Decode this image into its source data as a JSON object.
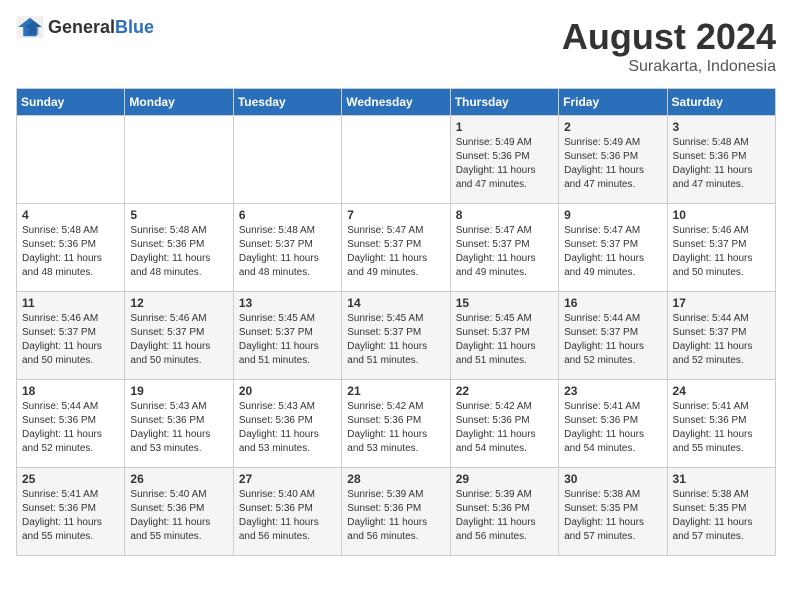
{
  "header": {
    "logo_general": "General",
    "logo_blue": "Blue",
    "title": "August 2024",
    "location": "Surakarta, Indonesia"
  },
  "calendar": {
    "days_of_week": [
      "Sunday",
      "Monday",
      "Tuesday",
      "Wednesday",
      "Thursday",
      "Friday",
      "Saturday"
    ],
    "weeks": [
      [
        {
          "day": "",
          "info": ""
        },
        {
          "day": "",
          "info": ""
        },
        {
          "day": "",
          "info": ""
        },
        {
          "day": "",
          "info": ""
        },
        {
          "day": "1",
          "info": "Sunrise: 5:49 AM\nSunset: 5:36 PM\nDaylight: 11 hours and 47 minutes."
        },
        {
          "day": "2",
          "info": "Sunrise: 5:49 AM\nSunset: 5:36 PM\nDaylight: 11 hours and 47 minutes."
        },
        {
          "day": "3",
          "info": "Sunrise: 5:48 AM\nSunset: 5:36 PM\nDaylight: 11 hours and 47 minutes."
        }
      ],
      [
        {
          "day": "4",
          "info": "Sunrise: 5:48 AM\nSunset: 5:36 PM\nDaylight: 11 hours and 48 minutes."
        },
        {
          "day": "5",
          "info": "Sunrise: 5:48 AM\nSunset: 5:36 PM\nDaylight: 11 hours and 48 minutes."
        },
        {
          "day": "6",
          "info": "Sunrise: 5:48 AM\nSunset: 5:37 PM\nDaylight: 11 hours and 48 minutes."
        },
        {
          "day": "7",
          "info": "Sunrise: 5:47 AM\nSunset: 5:37 PM\nDaylight: 11 hours and 49 minutes."
        },
        {
          "day": "8",
          "info": "Sunrise: 5:47 AM\nSunset: 5:37 PM\nDaylight: 11 hours and 49 minutes."
        },
        {
          "day": "9",
          "info": "Sunrise: 5:47 AM\nSunset: 5:37 PM\nDaylight: 11 hours and 49 minutes."
        },
        {
          "day": "10",
          "info": "Sunrise: 5:46 AM\nSunset: 5:37 PM\nDaylight: 11 hours and 50 minutes."
        }
      ],
      [
        {
          "day": "11",
          "info": "Sunrise: 5:46 AM\nSunset: 5:37 PM\nDaylight: 11 hours and 50 minutes."
        },
        {
          "day": "12",
          "info": "Sunrise: 5:46 AM\nSunset: 5:37 PM\nDaylight: 11 hours and 50 minutes."
        },
        {
          "day": "13",
          "info": "Sunrise: 5:45 AM\nSunset: 5:37 PM\nDaylight: 11 hours and 51 minutes."
        },
        {
          "day": "14",
          "info": "Sunrise: 5:45 AM\nSunset: 5:37 PM\nDaylight: 11 hours and 51 minutes."
        },
        {
          "day": "15",
          "info": "Sunrise: 5:45 AM\nSunset: 5:37 PM\nDaylight: 11 hours and 51 minutes."
        },
        {
          "day": "16",
          "info": "Sunrise: 5:44 AM\nSunset: 5:37 PM\nDaylight: 11 hours and 52 minutes."
        },
        {
          "day": "17",
          "info": "Sunrise: 5:44 AM\nSunset: 5:37 PM\nDaylight: 11 hours and 52 minutes."
        }
      ],
      [
        {
          "day": "18",
          "info": "Sunrise: 5:44 AM\nSunset: 5:36 PM\nDaylight: 11 hours and 52 minutes."
        },
        {
          "day": "19",
          "info": "Sunrise: 5:43 AM\nSunset: 5:36 PM\nDaylight: 11 hours and 53 minutes."
        },
        {
          "day": "20",
          "info": "Sunrise: 5:43 AM\nSunset: 5:36 PM\nDaylight: 11 hours and 53 minutes."
        },
        {
          "day": "21",
          "info": "Sunrise: 5:42 AM\nSunset: 5:36 PM\nDaylight: 11 hours and 53 minutes."
        },
        {
          "day": "22",
          "info": "Sunrise: 5:42 AM\nSunset: 5:36 PM\nDaylight: 11 hours and 54 minutes."
        },
        {
          "day": "23",
          "info": "Sunrise: 5:41 AM\nSunset: 5:36 PM\nDaylight: 11 hours and 54 minutes."
        },
        {
          "day": "24",
          "info": "Sunrise: 5:41 AM\nSunset: 5:36 PM\nDaylight: 11 hours and 55 minutes."
        }
      ],
      [
        {
          "day": "25",
          "info": "Sunrise: 5:41 AM\nSunset: 5:36 PM\nDaylight: 11 hours and 55 minutes."
        },
        {
          "day": "26",
          "info": "Sunrise: 5:40 AM\nSunset: 5:36 PM\nDaylight: 11 hours and 55 minutes."
        },
        {
          "day": "27",
          "info": "Sunrise: 5:40 AM\nSunset: 5:36 PM\nDaylight: 11 hours and 56 minutes."
        },
        {
          "day": "28",
          "info": "Sunrise: 5:39 AM\nSunset: 5:36 PM\nDaylight: 11 hours and 56 minutes."
        },
        {
          "day": "29",
          "info": "Sunrise: 5:39 AM\nSunset: 5:36 PM\nDaylight: 11 hours and 56 minutes."
        },
        {
          "day": "30",
          "info": "Sunrise: 5:38 AM\nSunset: 5:35 PM\nDaylight: 11 hours and 57 minutes."
        },
        {
          "day": "31",
          "info": "Sunrise: 5:38 AM\nSunset: 5:35 PM\nDaylight: 11 hours and 57 minutes."
        }
      ]
    ]
  }
}
